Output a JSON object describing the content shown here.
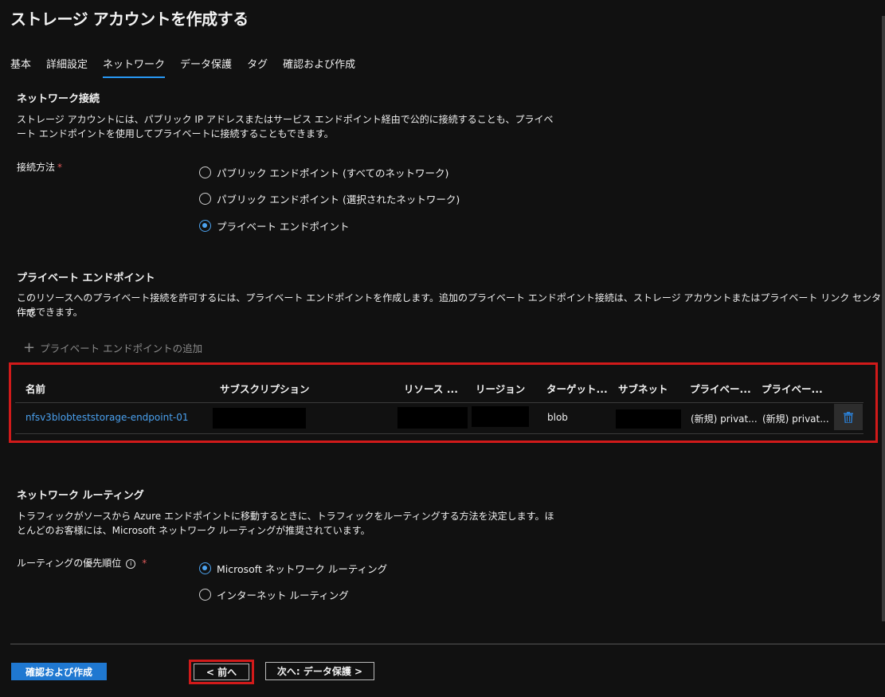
{
  "page_title": "ストレージ アカウントを作成する",
  "title_more": "…",
  "tabs": [
    {
      "label": "基本",
      "active": false
    },
    {
      "label": "詳細設定",
      "active": false
    },
    {
      "label": "ネットワーク",
      "active": true
    },
    {
      "label": "データ保護",
      "active": false
    },
    {
      "label": "タグ",
      "active": false
    },
    {
      "label": "確認および作成",
      "active": false
    }
  ],
  "network_connection": {
    "heading": "ネットワーク接続",
    "description_line1": "ストレージ アカウントには、パブリック IP アドレスまたはサービス エンドポイント経由で公的に接続することも、プライベ",
    "description_line2": "ート エンドポイントを使用してプライベートに接続することもできます。",
    "method_label": "接続方法",
    "required_mark": "*",
    "options": [
      {
        "label": "パブリック エンドポイント (すべてのネットワーク)",
        "selected": false
      },
      {
        "label": "パブリック エンドポイント (選択されたネットワーク)",
        "selected": false
      },
      {
        "label": "プライベート エンドポイント",
        "selected": true
      }
    ]
  },
  "private_endpoint": {
    "heading": "プライベート エンドポイント",
    "description_line1": "このリソースへのプライベート接続を許可するには、プライベート エンドポイントを作成します。追加のプライベート エンドポイント接続は、ストレージ アカウントまたはプライベート リンク センターで",
    "description_line2": "作成できます。",
    "add_label": "プライベート エンドポイントの追加",
    "columns": [
      "名前",
      "サブスクリプション",
      "リソース ...",
      "リージョン",
      "ターゲット...",
      "サブネット",
      "プライベー...",
      "プライベー..."
    ],
    "row": {
      "name": "nfsv3blobteststorage-endpoint-01",
      "target": "blob",
      "private_dns1": "(新規) privat...",
      "private_dns2": "(新規) privat..."
    },
    "trash_icon": "trash-icon"
  },
  "routing": {
    "heading": "ネットワーク ルーティング",
    "description_line1": "トラフィックがソースから Azure エンドポイントに移動するときに、トラフィックをルーティングする方法を決定します。ほ",
    "description_line2": "とんどのお客様には、Microsoft ネットワーク ルーティングが推奨されています。",
    "priority_label": "ルーティングの優先順位",
    "info_icon": "i",
    "required_mark": "*",
    "options": [
      {
        "label": "Microsoft ネットワーク ルーティング",
        "selected": true
      },
      {
        "label": "インターネット ルーティング",
        "selected": false
      }
    ]
  },
  "footer": {
    "review_button": "確認および作成",
    "prev_button": "< 前へ",
    "next_button": "次へ: データ保護 >"
  },
  "colors": {
    "accent": "#2899f5",
    "primary_button": "#1f78d1",
    "highlight_red": "#d11a1a",
    "link": "#4aa0ee"
  }
}
